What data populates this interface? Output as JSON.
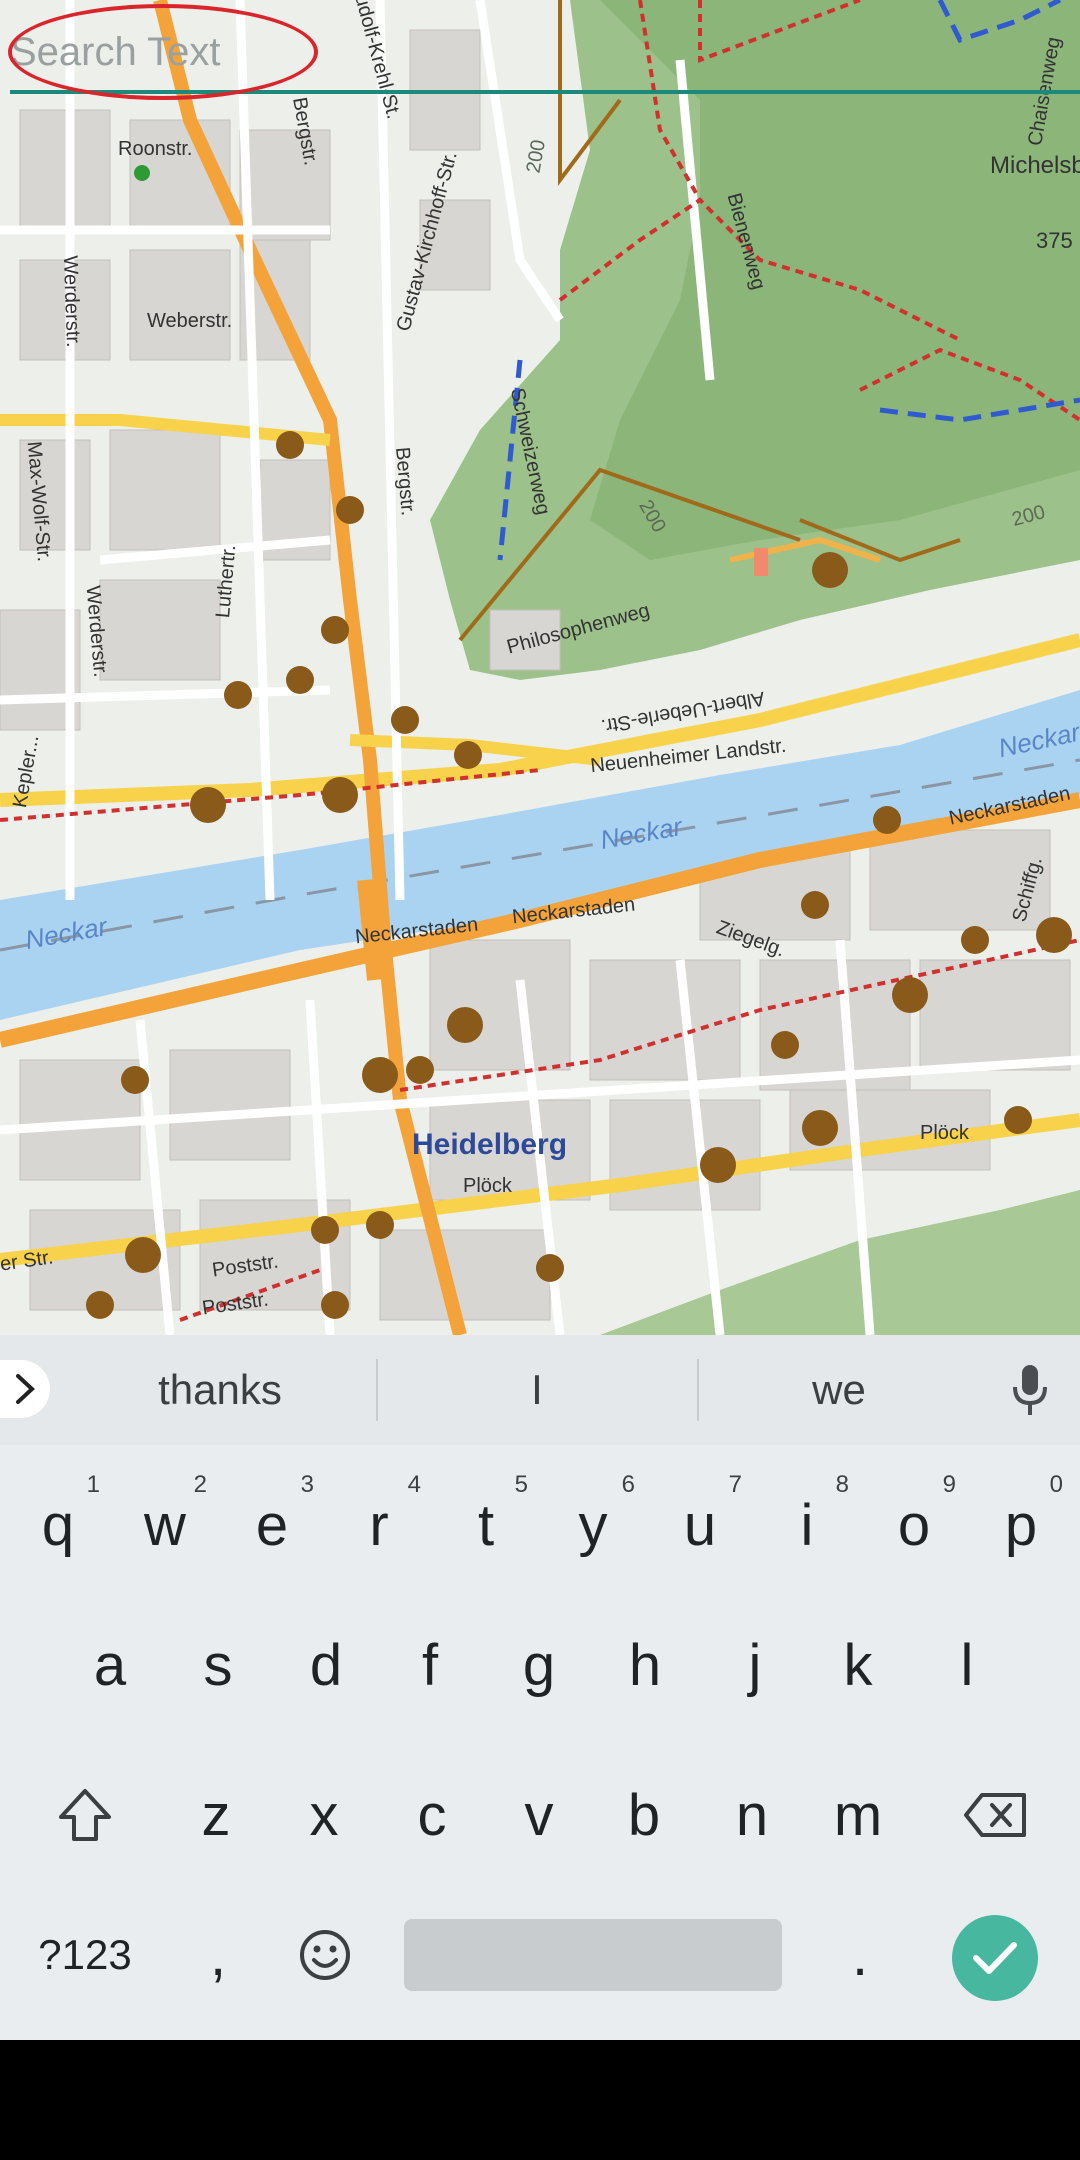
{
  "search": {
    "placeholder": "Search Text"
  },
  "map": {
    "city": "Heidelberg",
    "river_labels": [
      "Neckar",
      "Neckar",
      "Neckar"
    ],
    "streets": [
      "Ludolf-Krehl-St.",
      "Roonstr.",
      "Weberstr.",
      "Werderstr.",
      "Bergstr.",
      "Gustav-Kirchhoff-Str.",
      "Schweizerweg",
      "Bienenweg",
      "Chaisenweg",
      "Max-Wolf-Str.",
      "Luthertr.",
      "Werderstr.",
      "Philosophenweg",
      "Albert-Ueberle-Str.",
      "Neuenheimer Landstr.",
      "Neckarstaden",
      "Neckarstaden",
      "Neckarstaden",
      "Ziegelg.",
      "Plöck",
      "Plöck",
      "Schiffg.",
      "Poststr.",
      "Poststr.",
      "er Str.",
      "Bergstr.",
      "Kepler..."
    ],
    "place": "Michelsb",
    "elevation": "375",
    "contours": [
      "200",
      "200",
      "200"
    ]
  },
  "keyboard": {
    "suggestions": [
      "thanks",
      "I",
      "we"
    ],
    "row1": [
      {
        "k": "q",
        "n": "1"
      },
      {
        "k": "w",
        "n": "2"
      },
      {
        "k": "e",
        "n": "3"
      },
      {
        "k": "r",
        "n": "4"
      },
      {
        "k": "t",
        "n": "5"
      },
      {
        "k": "y",
        "n": "6"
      },
      {
        "k": "u",
        "n": "7"
      },
      {
        "k": "i",
        "n": "8"
      },
      {
        "k": "o",
        "n": "9"
      },
      {
        "k": "p",
        "n": "0"
      }
    ],
    "row2": [
      "a",
      "s",
      "d",
      "f",
      "g",
      "h",
      "j",
      "k",
      "l"
    ],
    "row3": [
      "z",
      "x",
      "c",
      "v",
      "b",
      "n",
      "m"
    ],
    "symbols_label": "?123",
    "comma": ",",
    "period": ".",
    "icons": {
      "expand": "chevron-right-icon",
      "mic": "microphone-icon",
      "shift": "shift-icon",
      "backspace": "backspace-icon",
      "emoji": "emoji-icon",
      "enter": "check-icon"
    },
    "accent_color": "#47b89f"
  }
}
